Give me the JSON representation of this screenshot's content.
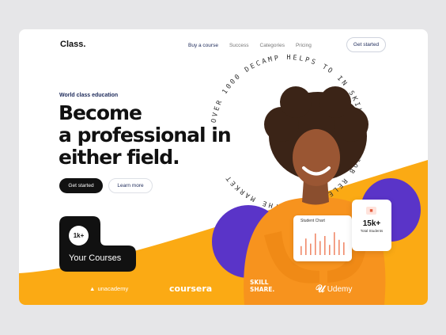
{
  "header": {
    "logo": "Class.",
    "nav": [
      "Buy a course",
      "Success",
      "Categories",
      "Pricing"
    ],
    "cta": "Get started"
  },
  "hero": {
    "eyebrow": "World class education",
    "headline": [
      "Become",
      "a professional in",
      "either field."
    ],
    "primary": "Get started",
    "secondary": "Learn more"
  },
  "courses": {
    "badge": "1k+",
    "label": "Your Courses"
  },
  "circle_text": "OVER 1000 DECAMP HELPS TO IN SKILLS FOR JOB RELEVANT TO THE MARKET",
  "chart_card": {
    "title": "Student Chart",
    "bars": [
      0.35,
      0.65,
      0.45,
      0.85,
      0.55,
      0.75,
      0.4,
      0.9,
      0.6,
      0.5
    ]
  },
  "stat_card": {
    "value": "15k+",
    "label": "Total Students"
  },
  "partners": {
    "unacademy": "unacademy",
    "coursera": "coursera",
    "skill": [
      "SKILL",
      "SHARE."
    ],
    "udemy": "Udemy"
  },
  "colors": {
    "accent": "#fbaa14",
    "purple": "#5a34c8",
    "ink": "#111111",
    "navy": "#1d2a5a"
  }
}
